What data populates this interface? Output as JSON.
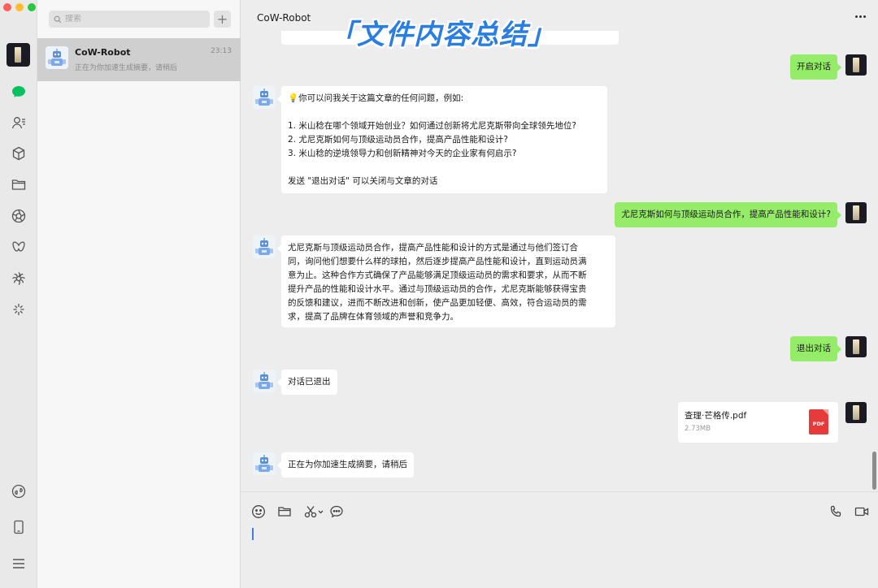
{
  "window": {
    "traffic_lights": [
      "#fe5f57",
      "#febc2e",
      "#28c840"
    ]
  },
  "rail": {
    "icons": [
      "chat-icon",
      "contacts-icon",
      "box-icon",
      "folder-icon",
      "aperture-icon",
      "butterfly-icon",
      "settings-flower-icon",
      "sparkle-icon",
      "mini-program-icon",
      "phone-device-icon",
      "menu-icon"
    ],
    "active_color": "#07c160"
  },
  "sidebar": {
    "search_placeholder": "搜索",
    "add_label": "+",
    "conversations": [
      {
        "name": "CoW-Robot",
        "time": "23:13",
        "preview": "正在为你加速生成摘要，请稍后"
      }
    ]
  },
  "chat": {
    "title": "CoW-Robot",
    "overlay_caption": "「文件内容总结」",
    "messages": [
      {
        "from": "me",
        "text": "开启对话"
      },
      {
        "from": "bot",
        "lines": [
          "💡你可以问我关于这篇文章的任何问题，例如:",
          "",
          "1. 米山稔在哪个领域开始创业？如何通过创新将尤尼克斯带向全球领先地位?",
          "2. 尤尼克斯如何与顶级运动员合作，提高产品性能和设计?",
          "3. 米山稔的逆境领导力和创新精神对今天的企业家有何启示?",
          "",
          "发送 \"退出对话\" 可以关闭与文章的对话"
        ]
      },
      {
        "from": "me",
        "text": "尤尼克斯如何与顶级运动员合作，提高产品性能和设计?"
      },
      {
        "from": "bot",
        "lines": [
          "尤尼克斯与顶级运动员合作，提高产品性能和设计的方式是通过与他们签订合",
          "同，询问他们想要什么样的球拍，然后逐步提高产品性能和设计，直到运动员满",
          "意为止。这种合作方式确保了产品能够满足顶级运动员的需求和要求，从而不断",
          "提升产品的性能和设计水平。通过与顶级运动员的合作，尤尼克斯能够获得宝贵",
          "的反馈和建议，进而不断改进和创新，使产品更加轻便、高效，符合运动员的需",
          "求，提高了品牌在体育领域的声誉和竞争力。"
        ]
      },
      {
        "from": "me",
        "text": "退出对话"
      },
      {
        "from": "bot",
        "text": "对话已退出"
      },
      {
        "from": "me",
        "file": {
          "name": "查理·芒格传.pdf",
          "size": "2.73MB",
          "type": "PDF"
        }
      },
      {
        "from": "bot",
        "text": "正在为你加速生成摘要，请稍后"
      }
    ]
  },
  "composer": {
    "tools": [
      "emoji-icon",
      "folder-icon",
      "scissors-icon",
      "chat-bubble-icon"
    ],
    "right_tools": [
      "phone-call-icon",
      "video-call-icon"
    ],
    "value": ""
  },
  "colors": {
    "bubble_me": "#95ec69",
    "bubble_bot": "#ffffff",
    "overlay_caption": "#2a7de1"
  }
}
